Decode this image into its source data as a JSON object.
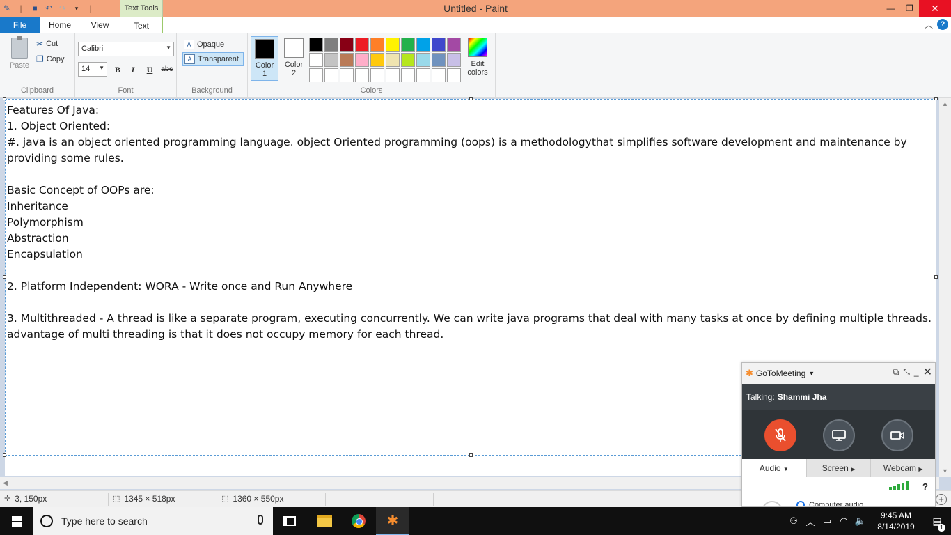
{
  "window": {
    "title": "Untitled - Paint",
    "context_tab_group": "Text Tools",
    "close_symbol": "✕",
    "min_symbol": "—",
    "max_symbol": "❐"
  },
  "tabs": {
    "file": "File",
    "home": "Home",
    "view": "View",
    "text": "Text"
  },
  "ribbon": {
    "clipboard": {
      "paste": "Paste",
      "cut": "Cut",
      "copy": "Copy",
      "label": "Clipboard"
    },
    "font": {
      "family": "Calibri",
      "size": "14",
      "bold": "B",
      "italic": "I",
      "underline": "U",
      "strike": "abc",
      "label": "Font"
    },
    "background": {
      "opaque": "Opaque",
      "transparent": "Transparent",
      "selected": "Transparent",
      "label": "Background"
    },
    "colors": {
      "color1_line1": "Color",
      "color1_line2": "1",
      "color2_line1": "Color",
      "color2_line2": "2",
      "color1_value": "#000000",
      "color2_value": "#ffffff",
      "edit_line1": "Edit",
      "edit_line2": "colors",
      "label": "Colors",
      "palette_row1": [
        "#000000",
        "#7f7f7f",
        "#880015",
        "#ed1c24",
        "#ff7f27",
        "#fff200",
        "#22b14c",
        "#00a2e8",
        "#3f48cc",
        "#a349a4"
      ],
      "palette_row2": [
        "#ffffff",
        "#c3c3c3",
        "#b97a57",
        "#ffaec9",
        "#ffc90e",
        "#efe4b0",
        "#b5e61d",
        "#99d9ea",
        "#7092be",
        "#c8bfe7"
      ],
      "palette_row3": [
        "#ffffff",
        "#ffffff",
        "#ffffff",
        "#ffffff",
        "#ffffff",
        "#ffffff",
        "#ffffff",
        "#ffffff",
        "#ffffff",
        "#ffffff"
      ]
    }
  },
  "canvas": {
    "lines": [
      "Features Of Java:",
      "1. Object Oriented:",
      "#. java is an object oriented programming language. object Oriented programming (oops) is a methodologythat simplifies software development and maintenance by",
      "providing some rules.",
      "",
      "Basic Concept of OOPs are:",
      "Inheritance",
      "Polymorphism",
      "Abstraction",
      "Encapsulation",
      "",
      "2. Platform Independent: WORA - Write once and Run Anywhere",
      "",
      "3. Multithreaded - A thread is like a separate program, executing concurrently. We can write java programs that deal with many tasks at once by defining multiple threads. The",
      "advantage of multi threading is that it does not occupy memory for each thread."
    ]
  },
  "statusbar": {
    "cursor_pos": "3, 150px",
    "selection_size": "1345 × 518px",
    "image_size": "1360 × 550px"
  },
  "gotomeeting": {
    "app_name": "GoToMeeting",
    "talking_label": "Talking:",
    "talking_name": "Shammi Jha",
    "tab_audio": "Audio",
    "tab_screen": "Screen",
    "tab_webcam": "Webcam",
    "audio_option": "Computer audio",
    "help": "?"
  },
  "taskbar": {
    "search_placeholder": "Type here to search",
    "time": "9:45 AM",
    "date": "8/14/2019",
    "notification_count": "1"
  }
}
